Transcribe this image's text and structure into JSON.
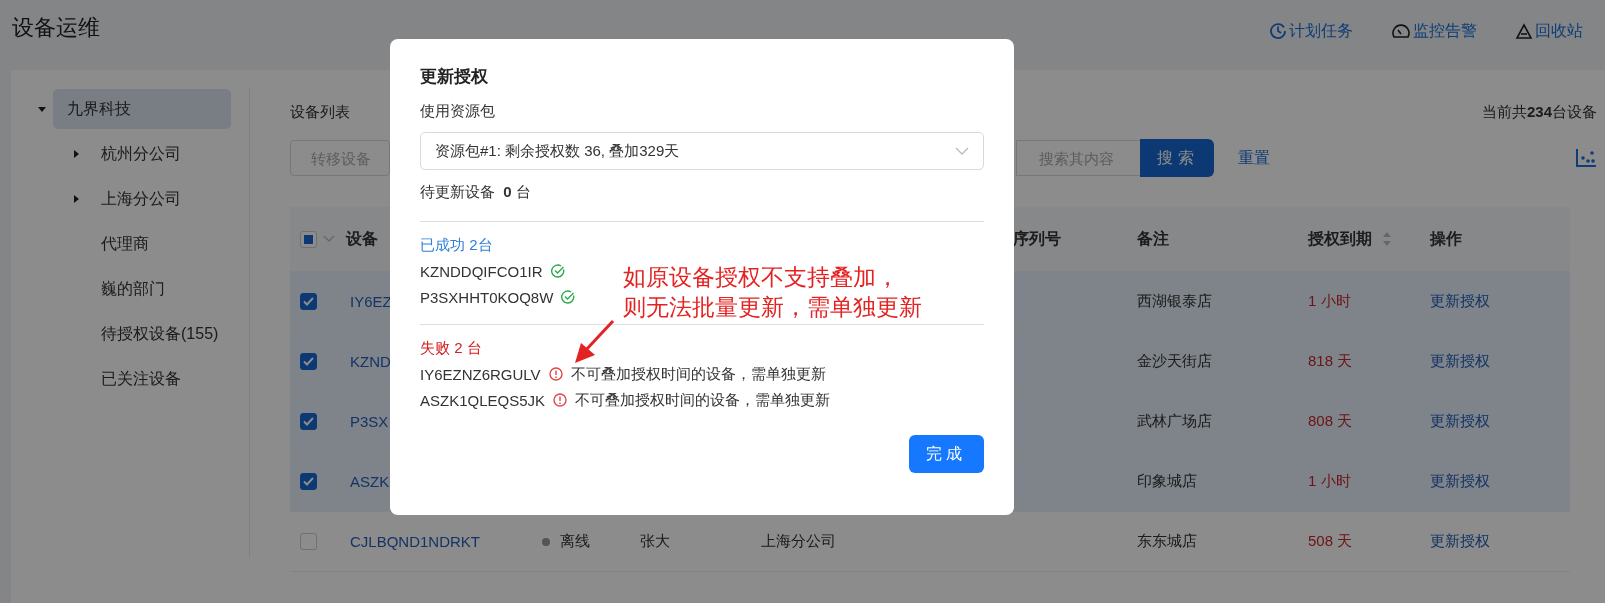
{
  "page_title": "设备运维",
  "header_links": [
    {
      "label": "计划任务"
    },
    {
      "label": "监控告警"
    },
    {
      "label": "回收站"
    }
  ],
  "sidebar": {
    "tree": [
      {
        "label": "九界科技",
        "kind": "branch",
        "expanded": true,
        "selected": true,
        "children": [
          {
            "label": "杭州分公司",
            "kind": "branch",
            "expanded": false,
            "selected": false
          },
          {
            "label": "上海分公司",
            "kind": "branch",
            "expanded": false,
            "selected": false
          },
          {
            "label": "代理商",
            "kind": "leaf",
            "selected": false
          },
          {
            "label": "巍的部门",
            "kind": "leaf",
            "selected": false
          },
          {
            "label": "待授权设备(155)",
            "kind": "leaf",
            "selected": false
          },
          {
            "label": "已关注设备",
            "kind": "leaf",
            "selected": false
          }
        ]
      }
    ]
  },
  "device_list": {
    "title": "设备列表",
    "total": "当前共**234**台设备"
  },
  "toolbar": {
    "transfer_placeholder": "转移设备",
    "search_placeholder": "搜索其内容",
    "search_button": "搜索",
    "reset_link": "重置"
  },
  "table": {
    "select_all_indeterminate": true,
    "columns": [
      {
        "label": "设备",
        "sortable": false
      },
      {
        "label": "序列号",
        "sortable": false
      },
      {
        "label": "备注",
        "sortable": false
      },
      {
        "label": "授权到期",
        "sortable": true
      },
      {
        "label": "操作",
        "sortable": false
      }
    ],
    "rows": [
      {
        "selected": true,
        "device_id": "IY6EZ",
        "remark": "西湖银泰店",
        "expiry": "1 小时",
        "action": "更新授权"
      },
      {
        "selected": true,
        "device_id": "KZND",
        "remark": "金沙天街店",
        "expiry": "818 天",
        "action": "更新授权"
      },
      {
        "selected": true,
        "device_id": "P3SX",
        "remark": "武林广场店",
        "expiry": "808 天",
        "action": "更新授权"
      },
      {
        "selected": true,
        "device_id": "ASZK",
        "remark": "印象城店",
        "expiry": "1 小时",
        "action": "更新授权"
      },
      {
        "selected": false,
        "device_id": "CJLBQND1NDRKT",
        "status": "离线",
        "owner": "张大",
        "org": "上海分公司",
        "remark": "东东城店",
        "expiry": "508 天",
        "action": "更新授权"
      }
    ]
  },
  "modal": {
    "title": "更新授权",
    "package_label": "使用资源包",
    "package_value": "资源包#1: 剩余授权数 36, 叠加329天",
    "pending": "待更新设备  **0** 台",
    "success": {
      "heading": "已成功 2台",
      "items": [
        "KZNDDQIFCO1IR",
        "P3SXHHT0KOQ8W"
      ]
    },
    "failed": {
      "heading": "失败 2 台",
      "items": [
        {
          "id": "IY6EZNZ6RGULV",
          "reason": "不可叠加授权时间的设备，需单独更新"
        },
        {
          "id": "ASZK1QLEQS5JK",
          "reason": "不可叠加授权时间的设备，需单独更新"
        }
      ]
    },
    "done_button": "完成"
  },
  "annotation": {
    "lines": [
      "如原设备授权不支持叠加，",
      "则无法批量更新，需单独更新"
    ]
  }
}
